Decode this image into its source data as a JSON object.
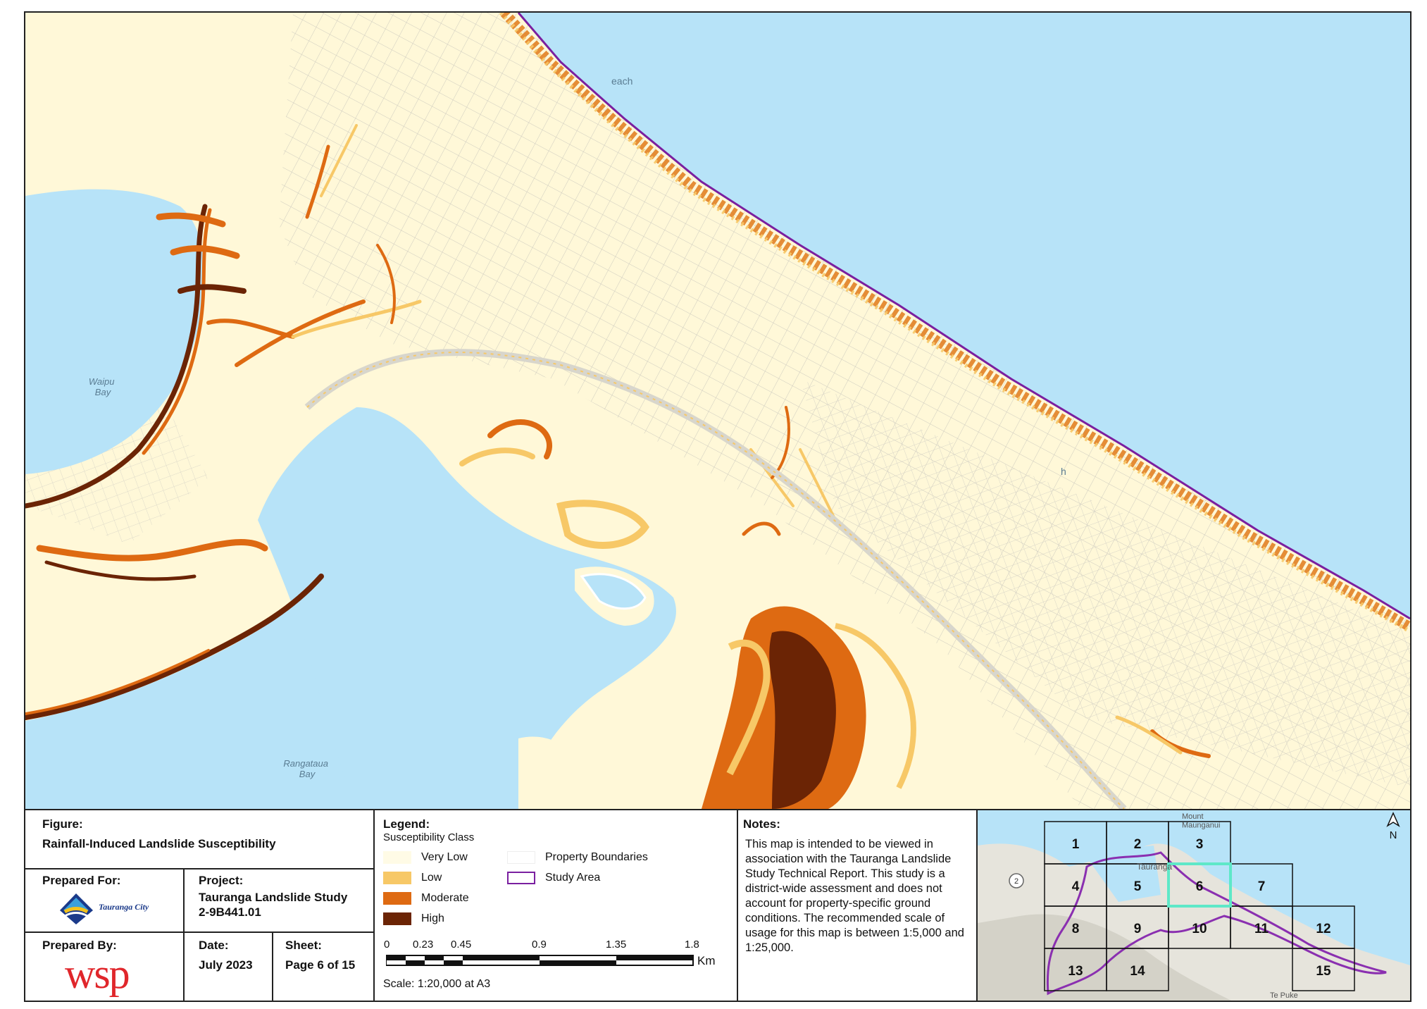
{
  "map": {
    "places": [
      "Waipu\nBay",
      "Rangataua\nBay",
      "each",
      "h"
    ],
    "colors": {
      "sea": "#b7e3f8",
      "land": "#fff8d8",
      "low": "#f7c867",
      "moderate": "#de6a12",
      "high": "#6b2405",
      "study_area": "#7a1fa0"
    }
  },
  "figure": {
    "heading": "Figure:",
    "title": "Rainfall-Induced Landslide Susceptibility"
  },
  "prepared_for": {
    "heading": "Prepared For:",
    "logo_text": "Tauranga City"
  },
  "project": {
    "heading": "Project:",
    "name": "Tauranga Landslide Study",
    "code": "2-9B441.01"
  },
  "prepared_by": {
    "heading": "Prepared By:",
    "logo_text": "wsp"
  },
  "date": {
    "heading": "Date:",
    "value": "July 2023"
  },
  "sheet": {
    "heading": "Sheet:",
    "value": "Page 6 of 15"
  },
  "legend": {
    "heading": "Legend:",
    "subheading": "Susceptibility Class",
    "classes": [
      {
        "label": "Very Low",
        "color": "#fffbe6"
      },
      {
        "label": "Low",
        "color": "#f7c867"
      },
      {
        "label": "Moderate",
        "color": "#de6a12"
      },
      {
        "label": "High",
        "color": "#6b2405"
      }
    ],
    "property_boundaries": "Property Boundaries",
    "study_area": "Study Area"
  },
  "scale": {
    "ticks": [
      "0",
      "0.23",
      "0.45",
      "0.9",
      "1.35",
      "1.8"
    ],
    "unit": "Km",
    "text": "Scale: 1:20,000 at A3"
  },
  "notes": {
    "heading": "Notes:",
    "text": "This map is intended to be viewed in association with the Tauranga Landslide Study Technical Report. This study is a district-wide assessment and does not account for property-specific ground conditions. The recommended scale of usage for this map is between 1:5,000 and 1:25,000."
  },
  "inset": {
    "sheets": [
      "1",
      "2",
      "3",
      "4",
      "5",
      "6",
      "7",
      "8",
      "9",
      "10",
      "11",
      "12",
      "13",
      "14",
      "15"
    ],
    "current_sheet": "6",
    "place_labels": [
      "Mount\nMaunganui",
      "Tauranga",
      "Te Puke"
    ],
    "road_shield": "2",
    "north": "N",
    "highlight_color": "#5ee8c8"
  }
}
